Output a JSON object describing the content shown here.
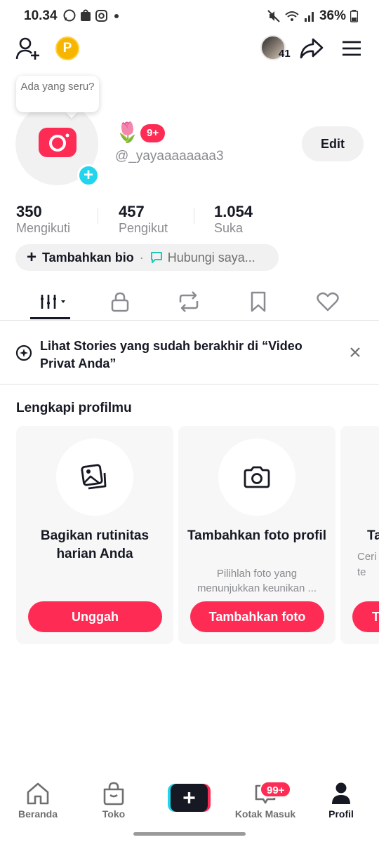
{
  "status_bar": {
    "time": "10.34",
    "battery": "36%"
  },
  "header": {
    "coin_label": "P",
    "story_count": "41"
  },
  "profile": {
    "bubble_text": "Ada yang seru?",
    "emoji": "🌷",
    "notif_badge": "9+",
    "username": "@_yayaaaaaaaa3",
    "edit_label": "Edit"
  },
  "stats": [
    {
      "value": "350",
      "label": "Mengikuti"
    },
    {
      "value": "457",
      "label": "Pengikut"
    },
    {
      "value": "1.054",
      "label": "Suka"
    }
  ],
  "bio": {
    "add_label": "Tambahkan bio",
    "separator": "·",
    "contact_label": "Hubungi saya..."
  },
  "stories_banner": {
    "text": "Lihat Stories yang sudah berakhir di “Video Privat Anda”"
  },
  "complete_profile": {
    "title": "Lengkapi profilmu",
    "cards": [
      {
        "icon": "photos-icon",
        "title": "Bagikan rutinitas harian Anda",
        "desc": "",
        "button": "Unggah"
      },
      {
        "icon": "camera-icon",
        "title": "Tambahkan foto profil",
        "desc": "Pilihlah foto yang menunjukkan keunikan ...",
        "button": "Tambahkan foto"
      },
      {
        "icon": "",
        "title": "Ta",
        "desc": "Ceri\nte",
        "button": "T"
      }
    ]
  },
  "bottom_nav": [
    {
      "label": "Beranda",
      "icon": "home-icon"
    },
    {
      "label": "Toko",
      "icon": "shop-icon"
    },
    {
      "label": "",
      "icon": "create-icon"
    },
    {
      "label": "Kotak Masuk",
      "icon": "inbox-icon",
      "badge": "99+"
    },
    {
      "label": "Profil",
      "icon": "profile-icon",
      "active": true
    }
  ],
  "colors": {
    "accent": "#fe2c55",
    "cyan": "#20d5ec",
    "text": "#161823",
    "muted": "#8a8b91",
    "coin": "#f7b500"
  }
}
